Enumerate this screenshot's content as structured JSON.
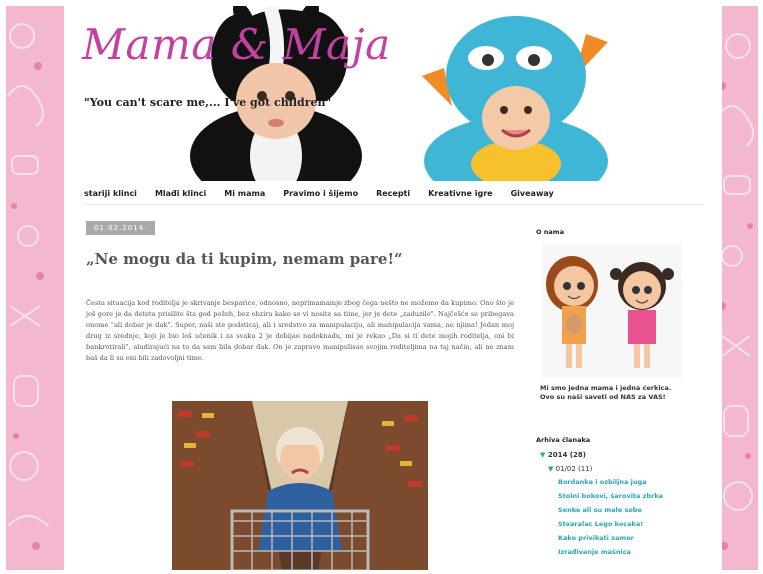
{
  "header": {
    "title": "Mama & Maja",
    "tagline": "\"You can't scare me,... I've got children\""
  },
  "nav": {
    "items": [
      "stariji klinci",
      "Mlađi klinci",
      "Mi mama",
      "Pravimo i šijemo",
      "Recepti",
      "Kreativne igre",
      "Giveaway"
    ]
  },
  "post": {
    "date": "01.02.2014.",
    "title": "„Ne mogu da ti kupim, nemam pare!“",
    "body": "Česta situacija kod roditelja je skrivanje besparice, odnosno, neprimamamje zbog čega nešto ne možemo da kupimo. Ono što je još gore je da deteta prisilite šta god požeh, bez obzira kako se vi nosite sa time, jer je dete „zaduzilo\". Najčešće se pribegava onome \"ali dobar je dak\". Super, naši ste podsticaj, ali i sredstvo za manipulaciju, ali manipulacija vama, ne njima! Jedan moj drug iz srednje, koji je bio loš učenik i za svaku 2 je dobijao nadoknadu, mi je rekao „Da si ti dete mojih roditelja, oni bi bankrotirali\", aludirajući na to da sam bila dobar đak. On je zapravo manipulisao svojim roditeljima na taj način, ali ne znam baš da li su oni bili zadovoljni time."
  },
  "sidebar": {
    "about_heading": "O nama",
    "about_text": "Mi smo jedna mama i jedna ćerkica. Ovo su naši saveti od NAS za VAS!",
    "archive_heading": "Arhiva članaka",
    "archive_year": "2014 (28)",
    "archive_month": "01/02 (11)",
    "archive_posts": [
      "Bordanka i ozbiljna juga",
      "Stolni bokovi, šarovita zbrka",
      "Senke ali su male sobe",
      "Stvaralac Lego kocaka!",
      "Kako privikati zamor",
      "Izrađivanje mašnica"
    ]
  },
  "colors": {
    "title": "#c341a0",
    "link": "#2aa6b4",
    "background_pattern": "#f3b7cf"
  }
}
